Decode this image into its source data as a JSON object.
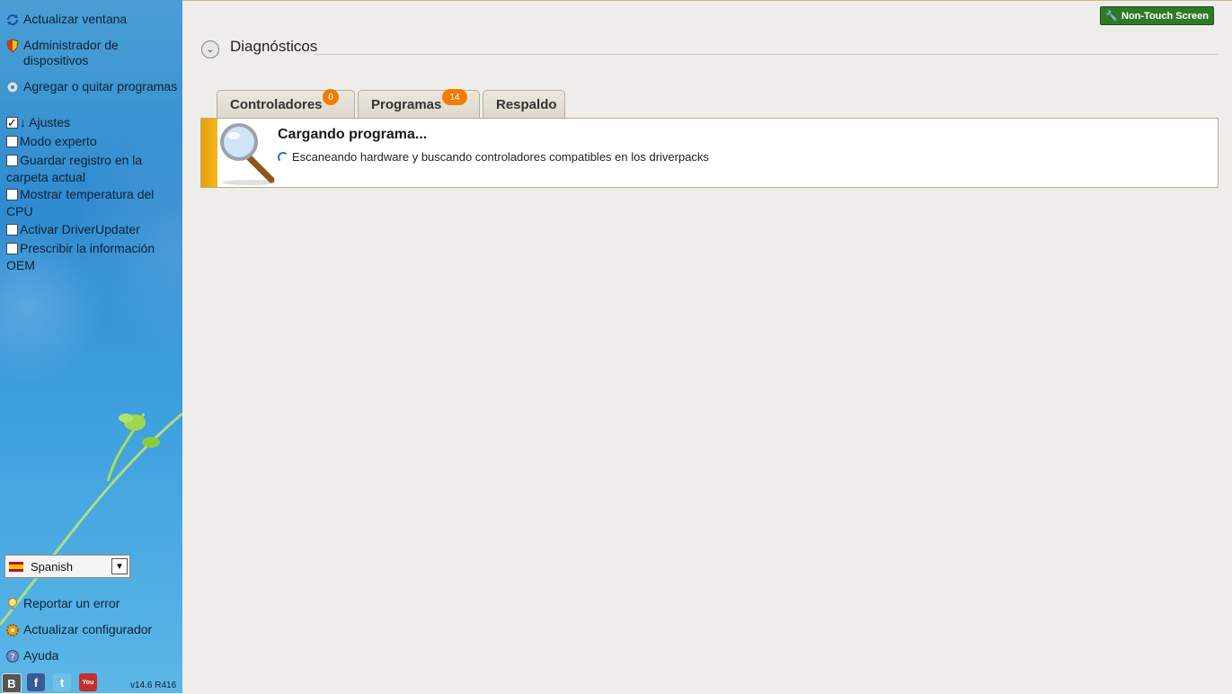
{
  "sidebar": {
    "links_top": [
      {
        "label": "Actualizar ventana",
        "icon": "refresh-icon"
      },
      {
        "label": "Administrador de dispositivos",
        "icon": "shield-icon"
      },
      {
        "label": "Agregar o quitar programas",
        "icon": "programs-icon"
      }
    ],
    "settings_header": "↓ Ajustes",
    "settings": [
      {
        "label": "Modo experto",
        "checked": false
      },
      {
        "label": "Guardar registro en la carpeta actual",
        "checked": false
      },
      {
        "label": "Mostrar temperatura del CPU",
        "checked": false
      },
      {
        "label": "Activar DriverUpdater",
        "checked": false
      },
      {
        "label": "Prescribir la información OEM",
        "checked": false
      }
    ],
    "language": "Spanish",
    "links_bottom": [
      {
        "label": "Reportar un error",
        "icon": "bulb-icon"
      },
      {
        "label": "Actualizar configurador",
        "icon": "gear-icon"
      },
      {
        "label": "Ayuda",
        "icon": "help-icon"
      }
    ],
    "social": [
      "B",
      "f",
      "t",
      "You"
    ],
    "version": "v14.6 R416"
  },
  "header": {
    "non_touch_label": "Non-Touch Screen",
    "section_title": "Diagnósticos"
  },
  "tabs": [
    {
      "label": "Controladores",
      "badge": "0"
    },
    {
      "label": "Programas",
      "badge": "14"
    },
    {
      "label": "Respaldo",
      "badge": ""
    }
  ],
  "loading": {
    "title": "Cargando programa...",
    "subtitle": "Escaneando hardware y buscando controladores compatibles en los driverpacks"
  },
  "colors": {
    "accent_orange": "#f07d00",
    "panel_bar": "#e8a000",
    "button_green": "#2f7a2a",
    "sidebar_blue": "#2f8bd0"
  }
}
